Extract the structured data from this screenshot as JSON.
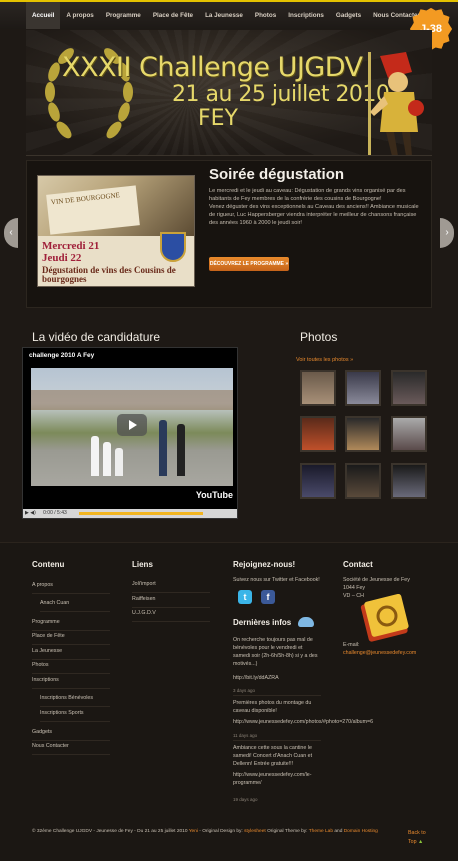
{
  "nav": {
    "items": [
      "Accueil",
      "A propos",
      "Programme",
      "Place de Fête",
      "La Jeunesse",
      "Photos",
      "Inscriptions",
      "Gadgets",
      "Nous Contacter"
    ],
    "badge": "J-38"
  },
  "banner": {
    "title": "XXXII Challenge UJGDV",
    "dates": "21 au 25 juillet 2010",
    "place": "FEY"
  },
  "slide": {
    "photo_label_1": "Mercredi 21",
    "photo_label_2": "Jeudi 22",
    "photo_label_3": "Dégustation de vins des Cousins de bourgognes",
    "photo_bottle_text": "VIN DE BOURGOGNE",
    "title": "Soirée dégustation",
    "p1": "Le mercredi et le jeudi au caveau: Dégustation de grands vins organisé par des habitants de Fey membres de la confrérie des cousins de Bourgogne!",
    "p2": "Venez déguster des vins exceptionnels au Caveau des anciens!! Ambiance musicale de rigueur, Luc Happersberger viendra interpréter le meilleur de chansons française des années 1960 à 2000 le jeudi soir!",
    "button": "DÉCOUVREZ LE PROGRAMME »"
  },
  "video": {
    "heading": "La vidéo de candidature",
    "title": "challenge 2010 A Fey",
    "time": "0:00 / 5:43",
    "brand": "YouTube"
  },
  "photos": {
    "heading": "Photos",
    "link": "Voir toutes les photos »"
  },
  "footer": {
    "contenu": {
      "title": "Contenu",
      "items": [
        "A propos",
        "Anach Cuan",
        "Programme",
        "Place de Fête",
        "La Jeunesse",
        "Photos",
        "Inscriptions",
        "Inscriptions Bénévoles",
        "Inscriptions Sports",
        "Gadgets",
        "Nous Contacter"
      ]
    },
    "liens": {
      "title": "Liens",
      "items": [
        "Joli'import",
        "Raiffeisen",
        "U.J.G.D.V"
      ]
    },
    "rejoignez": {
      "title": "Rejoignez-nous!",
      "text": "Suivez nous sur Twitter et Facebook!"
    },
    "infos": {
      "title": "Dernières infos",
      "entries": [
        {
          "text": "On recherche toujours pas mal de bénévoles pour le vendredi et samedi soir (2h-6h/5h-8h) si y a des motivés...)",
          "link": "http://bit.ly/ddAZRA",
          "date": "3 days ago"
        },
        {
          "text": "Premières photos du montage du caveau disponible!",
          "link": "http://www.jeunessedefey.com/photos/#photo=270/album=6",
          "date": "11 days ago"
        },
        {
          "text": "Ambiance cette sous la cantine le samedi! Concert d'Anach Cuan et Dellenn! Entrée gratuite!!!",
          "link": "http://www.jeunessedefey.com/le-programme/",
          "date": "19 days ago"
        }
      ]
    },
    "contact": {
      "title": "Contact",
      "lines": [
        "Société de Jeunesse de Fey",
        "1044 Fey",
        "VD – CH"
      ],
      "email_label": "E-mail:",
      "email": "challenge@jeunessedefey.com"
    },
    "bottom": {
      "copyright": "© 32ème Challenge UJGDV - Jeunesse de Fey - Du 21 au 25 juillet 2010",
      "theme_name": "Yeni",
      "original_design": "- Original Design by:",
      "designer": "stylesheet",
      "original_theme": "Original Theme by:",
      "theme_by": "Theme Lab",
      "and": "and",
      "host": "Domain Hosting",
      "back": "Back to",
      "top": "Top"
    }
  },
  "colors": {
    "accent": "#e98a2e",
    "nav_border": "#e4c200",
    "banner_text": "#e6d86a"
  }
}
